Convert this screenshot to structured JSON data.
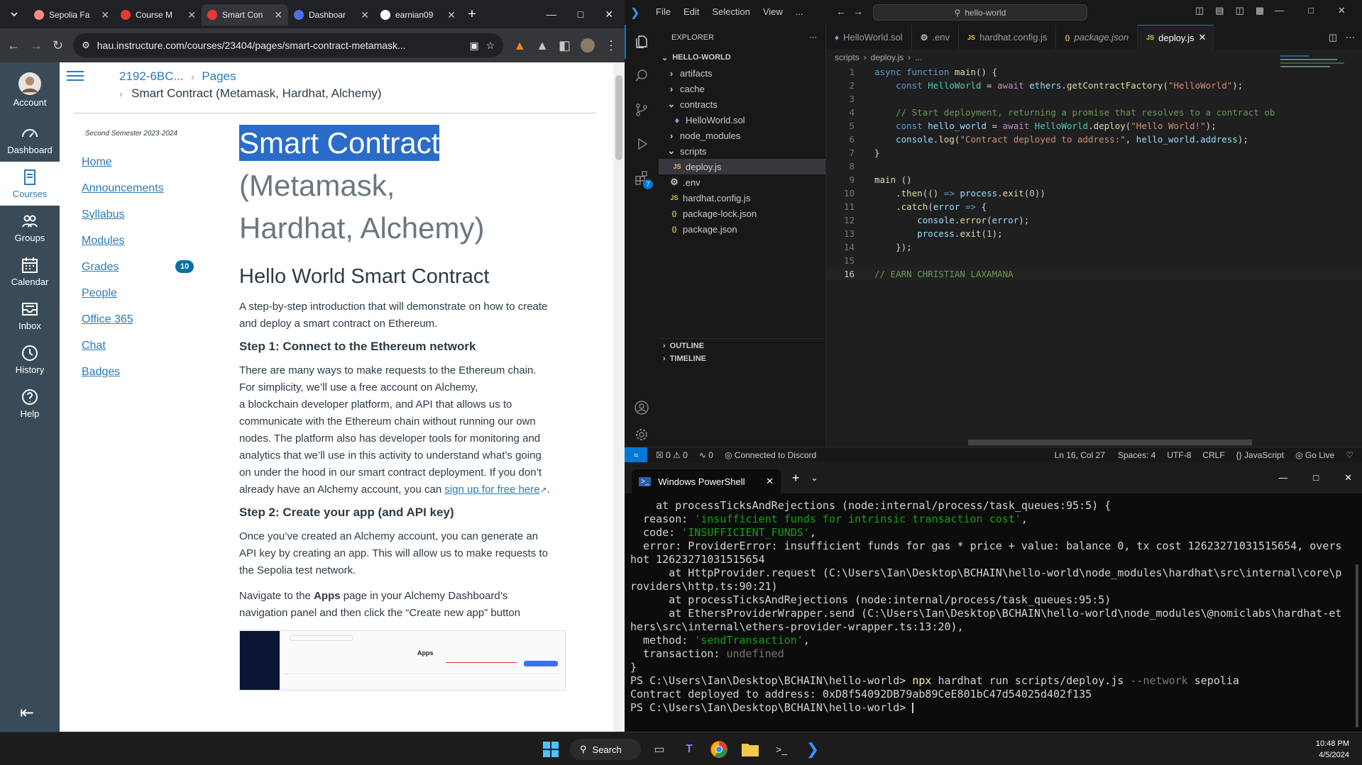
{
  "chrome": {
    "tabs": [
      {
        "title": "Sepolia Fa",
        "color": "#f28b82"
      },
      {
        "title": "Course M",
        "color": "#e53935"
      },
      {
        "title": "Smart Con",
        "color": "#e53935",
        "active": true
      },
      {
        "title": "Dashboar",
        "color": "#4f6fe6"
      },
      {
        "title": "earnian09",
        "color": "#ffffff"
      }
    ],
    "url": "hau.instructure.com/courses/23404/pages/smart-contract-metamask..."
  },
  "canvas_nav": [
    {
      "label": "Account",
      "icon": "account-avatar"
    },
    {
      "label": "Dashboard",
      "icon": "dashboard-icon"
    },
    {
      "label": "Courses",
      "icon": "courses-icon",
      "active": true
    },
    {
      "label": "Groups",
      "icon": "groups-icon"
    },
    {
      "label": "Calendar",
      "icon": "calendar-icon"
    },
    {
      "label": "Inbox",
      "icon": "inbox-icon"
    },
    {
      "label": "History",
      "icon": "history-icon"
    },
    {
      "label": "Help",
      "icon": "help-icon"
    }
  ],
  "page": {
    "breadcrumb_course": "2192-6BC...",
    "breadcrumb_pages": "Pages",
    "breadcrumb_current": "Smart Contract (Metamask, Hardhat, Alchemy)",
    "semester": "Second Semester 2023-2024",
    "course_nav": [
      {
        "label": "Home"
      },
      {
        "label": "Announcements"
      },
      {
        "label": "Syllabus"
      },
      {
        "label": "Modules"
      },
      {
        "label": "Grades",
        "badge": "10"
      },
      {
        "label": "People"
      },
      {
        "label": "Office 365"
      },
      {
        "label": "Chat"
      },
      {
        "label": "Badges"
      }
    ],
    "title_highlight": "Smart Contract",
    "title_rest": "(Metamask, Hardhat, Alchemy)",
    "h2": "Hello World Smart Contract",
    "intro": "A step-by-step introduction that will demonstrate on how to create and deploy a smart contract on Ethereum.",
    "step1_title": "Step 1: Connect to the Ethereum network",
    "step1_text": "There are many ways to make requests to the Ethereum chain. For simplicity, we’ll use a free account on Alchemy,",
    "step1_text2": "a blockchain developer platform, and API that allows us to communicate with the Ethereum chain without running our own nodes. The platform also has developer tools for monitoring and analytics that we’ll use in this activity to understand what’s going on under the hood in our smart contract deployment. If you don’t already have an Alchemy account, you can",
    "step1_link": "sign up for free here",
    "step2_title": "Step 2: Create your app (and API key)",
    "step2_text": "Once you’ve created an Alchemy account, you can generate an API key by creating an app. This will allow us to make requests to the Sepolia test network.",
    "step2_text2_a": "Navigate to the",
    "step2_text2_bold": "Apps",
    "step2_text2_b": "page in your Alchemy Dashboard’s navigation panel and then click the “Create new app” button",
    "screenshot_heading": "Apps"
  },
  "vscode": {
    "menu": [
      "File",
      "Edit",
      "Selection",
      "View",
      "..."
    ],
    "search": "hello-world",
    "explorer_title": "EXPLORER",
    "project": "HELLO-WORLD",
    "tree": [
      {
        "label": "artifacts",
        "type": "folder",
        "depth": 0
      },
      {
        "label": "cache",
        "type": "folder",
        "depth": 0
      },
      {
        "label": "contracts",
        "type": "folder-open",
        "depth": 0
      },
      {
        "label": "HelloWorld.sol",
        "type": "sol",
        "depth": 1
      },
      {
        "label": "node_modules",
        "type": "folder",
        "depth": 0
      },
      {
        "label": "scripts",
        "type": "folder-open",
        "depth": 0
      },
      {
        "label": "deploy.js",
        "type": "js",
        "depth": 1,
        "selected": true
      },
      {
        "label": ".env",
        "type": "env",
        "depth": 0
      },
      {
        "label": "hardhat.config.js",
        "type": "js",
        "depth": 0
      },
      {
        "label": "package-lock.json",
        "type": "json",
        "depth": 0
      },
      {
        "label": "package.json",
        "type": "json",
        "depth": 0
      }
    ],
    "outline": "OUTLINE",
    "timeline": "TIMELINE",
    "tabs": [
      {
        "label": "HelloWorld.sol",
        "icon": "sol"
      },
      {
        "label": ".env",
        "icon": "env"
      },
      {
        "label": "hardhat.config.js",
        "icon": "js"
      },
      {
        "label": "package.json",
        "icon": "json"
      },
      {
        "label": "deploy.js",
        "icon": "js",
        "active": true
      }
    ],
    "editor_breadcrumb": [
      "scripts",
      "deploy.js",
      "..."
    ],
    "status": {
      "errors": "0",
      "warnings": "0",
      "ports": "0",
      "discord": "Connected to Discord",
      "position": "Ln 16, Col 27",
      "spaces": "Spaces: 4",
      "encoding": "UTF-8",
      "eol": "CRLF",
      "language": "JavaScript",
      "golive": "Go Live"
    }
  },
  "code_lines": [
    [
      [
        "kw",
        "async "
      ],
      [
        "kw",
        "function "
      ],
      [
        "fn",
        "main"
      ],
      [
        "pl",
        "() {"
      ]
    ],
    [
      [
        "pl",
        "    "
      ],
      [
        "kw",
        "const "
      ],
      [
        "cls",
        "HelloWorld"
      ],
      [
        "pl",
        " = "
      ],
      [
        "kw2",
        "await "
      ],
      [
        "var",
        "ethers"
      ],
      [
        "pl",
        "."
      ],
      [
        "fn",
        "getContractFactory"
      ],
      [
        "pl",
        "("
      ],
      [
        "str",
        "\"HelloWorld\""
      ],
      [
        "pl",
        ");"
      ]
    ],
    [
      [
        "pl",
        ""
      ]
    ],
    [
      [
        "pl",
        "    "
      ],
      [
        "cm",
        "// Start deployment, returning a promise that resolves to a contract ob"
      ]
    ],
    [
      [
        "pl",
        "    "
      ],
      [
        "kw",
        "const "
      ],
      [
        "var",
        "hello_world"
      ],
      [
        "pl",
        " = "
      ],
      [
        "kw2",
        "await "
      ],
      [
        "cls",
        "HelloWorld"
      ],
      [
        "pl",
        "."
      ],
      [
        "fn",
        "deploy"
      ],
      [
        "pl",
        "("
      ],
      [
        "str",
        "\"Hello World!\""
      ],
      [
        "pl",
        ");"
      ]
    ],
    [
      [
        "pl",
        "    "
      ],
      [
        "var",
        "console"
      ],
      [
        "pl",
        "."
      ],
      [
        "fn",
        "log"
      ],
      [
        "pl",
        "("
      ],
      [
        "str",
        "\"Contract deployed to address:\""
      ],
      [
        "pl",
        ", "
      ],
      [
        "var",
        "hello_world"
      ],
      [
        "pl",
        "."
      ],
      [
        "var",
        "address"
      ],
      [
        "pl",
        ");"
      ]
    ],
    [
      [
        "pl",
        "}"
      ]
    ],
    [
      [
        "pl",
        ""
      ]
    ],
    [
      [
        "fn",
        "main"
      ],
      [
        "pl",
        " ()"
      ]
    ],
    [
      [
        "pl",
        "    ."
      ],
      [
        "fn",
        "then"
      ],
      [
        "pl",
        "(() "
      ],
      [
        "kw",
        "=>"
      ],
      [
        "pl",
        " "
      ],
      [
        "var",
        "process"
      ],
      [
        "pl",
        "."
      ],
      [
        "fn",
        "exit"
      ],
      [
        "pl",
        "("
      ],
      [
        "num",
        "0"
      ],
      [
        "pl",
        "))"
      ]
    ],
    [
      [
        "pl",
        "    ."
      ],
      [
        "fn",
        "catch"
      ],
      [
        "pl",
        "("
      ],
      [
        "var",
        "error"
      ],
      [
        "pl",
        " "
      ],
      [
        "kw",
        "=>"
      ],
      [
        "pl",
        " {"
      ]
    ],
    [
      [
        "pl",
        "        "
      ],
      [
        "var",
        "console"
      ],
      [
        "pl",
        "."
      ],
      [
        "fn",
        "error"
      ],
      [
        "pl",
        "("
      ],
      [
        "var",
        "error"
      ],
      [
        "pl",
        ");"
      ]
    ],
    [
      [
        "pl",
        "        "
      ],
      [
        "var",
        "process"
      ],
      [
        "pl",
        "."
      ],
      [
        "fn",
        "exit"
      ],
      [
        "pl",
        "("
      ],
      [
        "num",
        "1"
      ],
      [
        "pl",
        ");"
      ]
    ],
    [
      [
        "pl",
        "    });"
      ]
    ],
    [
      [
        "pl",
        ""
      ]
    ],
    [
      [
        "cm",
        "// EARN CHRISTIAN LAXAMANA"
      ]
    ]
  ],
  "powershell": {
    "tab_title": "Windows PowerShell",
    "lines": [
      [
        [
          "pl",
          "    at processTicksAndRejections (node:internal/process/task_queues:95:5) {"
        ]
      ],
      [
        [
          "pl",
          "  reason: "
        ],
        [
          "g",
          "'insufficient funds for intrinsic transaction cost'"
        ],
        [
          "pl",
          ","
        ]
      ],
      [
        [
          "pl",
          "  code: "
        ],
        [
          "g",
          "'INSUFFICIENT_FUNDS'"
        ],
        [
          "pl",
          ","
        ]
      ],
      [
        [
          "pl",
          "  error: ProviderError: insufficient funds for gas * price + value: balance 0, tx cost 12623271031515654, overs"
        ]
      ],
      [
        [
          "pl",
          "hot 12623271031515654"
        ]
      ],
      [
        [
          "pl",
          "      at HttpProvider.request (C:\\Users\\Ian\\Desktop\\BCHAIN\\hello-world\\node_modules\\hardhat\\src\\internal\\core\\p"
        ]
      ],
      [
        [
          "pl",
          "roviders\\http.ts:90:21)"
        ]
      ],
      [
        [
          "pl",
          "      at processTicksAndRejections (node:internal/process/task_queues:95:5)"
        ]
      ],
      [
        [
          "pl",
          "      at EthersProviderWrapper.send (C:\\Users\\Ian\\Desktop\\BCHAIN\\hello-world\\node_modules\\@nomiclabs\\hardhat-et"
        ]
      ],
      [
        [
          "pl",
          "hers\\src\\internal\\ethers-provider-wrapper.ts:13:20),"
        ]
      ],
      [
        [
          "pl",
          "  method: "
        ],
        [
          "g",
          "'sendTransaction'"
        ],
        [
          "pl",
          ","
        ]
      ],
      [
        [
          "pl",
          "  transaction: "
        ],
        [
          "gr",
          "undefined"
        ]
      ],
      [
        [
          "pl",
          "}"
        ]
      ],
      [
        [
          "pl",
          "PS C:\\Users\\Ian\\Desktop\\BCHAIN\\hello-world> "
        ],
        [
          "y",
          "npx"
        ],
        [
          "pl",
          " hardhat run scripts/deploy.js "
        ],
        [
          "gr",
          "--network"
        ],
        [
          "pl",
          " sepolia"
        ]
      ],
      [
        [
          "pl",
          "Contract deployed to address: 0xD8f54092DB79ab89CeE801bC47d54025d402f135"
        ]
      ],
      [
        [
          "pl",
          "PS C:\\Users\\Ian\\Desktop\\BCHAIN\\hello-world> "
        ]
      ]
    ]
  },
  "taskbar": {
    "search": "Search",
    "time": "10:48 PM",
    "date": "4/5/2024"
  },
  "colors": {
    "canvas_nav_bg": "#394B58",
    "canvas_link": "#2b7abc",
    "badge": "#0770a3",
    "vscode_accent": "#0078d4"
  }
}
